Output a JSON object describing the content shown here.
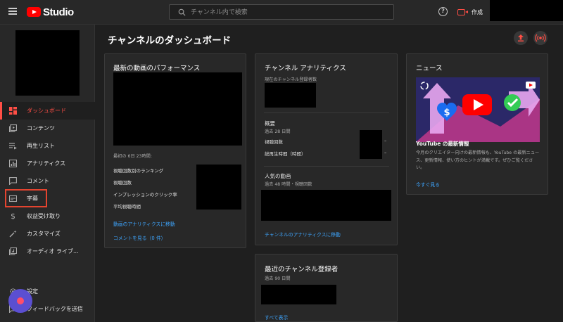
{
  "app": {
    "logo_text": "Studio"
  },
  "search": {
    "placeholder": "チャンネル内で検索"
  },
  "header": {
    "help_glyph": "?",
    "create_label": "作成"
  },
  "sidebar": {
    "items": [
      {
        "label": "ダッシュボード",
        "icon": "dashboard-icon",
        "active": true
      },
      {
        "label": "コンテンツ",
        "icon": "content-icon"
      },
      {
        "label": "再生リスト",
        "icon": "playlist-icon"
      },
      {
        "label": "アナリティクス",
        "icon": "analytics-icon"
      },
      {
        "label": "コメント",
        "icon": "comment-icon"
      },
      {
        "label": "字幕",
        "icon": "subtitles-icon",
        "highlighted": true
      },
      {
        "label": "収益受け取り",
        "icon": "dollar-icon"
      },
      {
        "label": "カスタマイズ",
        "icon": "magic-wand-icon"
      },
      {
        "label": "オーディオ ライブ...",
        "icon": "audio-library-icon"
      }
    ],
    "bottom": [
      {
        "label": "設定",
        "icon": "gear-icon"
      },
      {
        "label": "フィードバックを送信",
        "icon": "feedback-icon"
      }
    ]
  },
  "main": {
    "title": "チャンネルのダッシュボード",
    "performance": {
      "title": "最新の動画のパフォーマンス",
      "elapsed": "最初の 6日 23時間:",
      "metrics": [
        "視聴回数別のランキング",
        "視聴回数",
        "インプレッションのクリック率",
        "平均視聴時間"
      ],
      "analytics_link": "動画のアナリティクスに移動",
      "comments_link": "コメントを見る（0 件）"
    },
    "analytics": {
      "title": "チャンネル アナリティクス",
      "subscribers_label": "現在のチャンネル登録者数",
      "summary_title": "概要",
      "summary_period": "過去 28 日間",
      "views_label": "視聴回数",
      "views_value": "–",
      "watchtime_label": "総再生時間（時間）",
      "watchtime_value": "–",
      "popular_title": "人気の動画",
      "popular_period": "過去 48 時間・視聴回数",
      "link": "チャンネルのアナリティクスに移動"
    },
    "subscribers": {
      "title": "最近のチャンネル登録者",
      "period": "過去 90 日間",
      "link": "すべて表示"
    },
    "news": {
      "title": "ニュース",
      "headline": "YouTube の最新情報",
      "body": "今月のクリエイター向けの最新情報も、YouTube の最新ニュース、更新情報、使い方のヒントが満載です。ぜひご覧ください。",
      "link": "今すぐ見る"
    }
  },
  "colors": {
    "accent": "#ff4e45",
    "link": "#3ea6ff",
    "highlight_box": "#e4442f",
    "fab": "#5b4fd1"
  }
}
